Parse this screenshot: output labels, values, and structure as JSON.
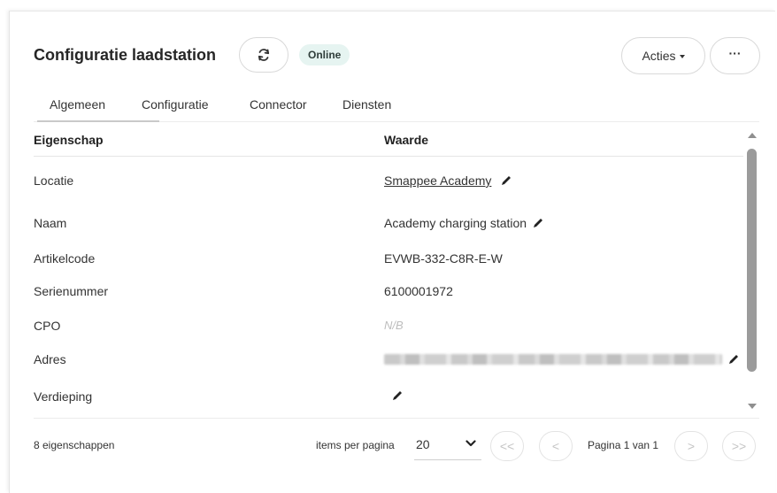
{
  "header": {
    "title": "Configuratie laadstation",
    "status_badge": "Online",
    "actions_label": "Acties",
    "more_label": "···"
  },
  "tabs": [
    {
      "label": "Algemeen",
      "active": true
    },
    {
      "label": "Configuratie",
      "active": false
    },
    {
      "label": "Connector",
      "active": false
    },
    {
      "label": "Diensten",
      "active": false
    }
  ],
  "table": {
    "columns": [
      "Eigenschap",
      "Waarde"
    ],
    "rows": [
      {
        "property": "Locatie",
        "value": "Smappee Academy",
        "link": true,
        "editable": true
      },
      {
        "property": "Naam",
        "value": "Academy charging station",
        "editable": true
      },
      {
        "property": "Artikelcode",
        "value": "EVWB-332-C8R-E-W"
      },
      {
        "property": "Serienummer",
        "value": "6100001972"
      },
      {
        "property": "CPO",
        "value": "N/B",
        "empty": true
      },
      {
        "property": "Adres",
        "value": "",
        "redacted": true,
        "editable": true
      },
      {
        "property": "Verdieping",
        "value": "",
        "editable": true
      }
    ]
  },
  "footer": {
    "count": "8 eigenschappen",
    "items_per_page_label": "items per pagina",
    "items_per_page": "20",
    "page_info": "Pagina 1 van 1",
    "first": "<<",
    "prev": "<",
    "next": ">",
    "last": ">>"
  },
  "colors": {
    "badge_bg": "#e6f4f1",
    "scrollbar": "#9b9b9b",
    "disabled": "#c4c4c4"
  }
}
